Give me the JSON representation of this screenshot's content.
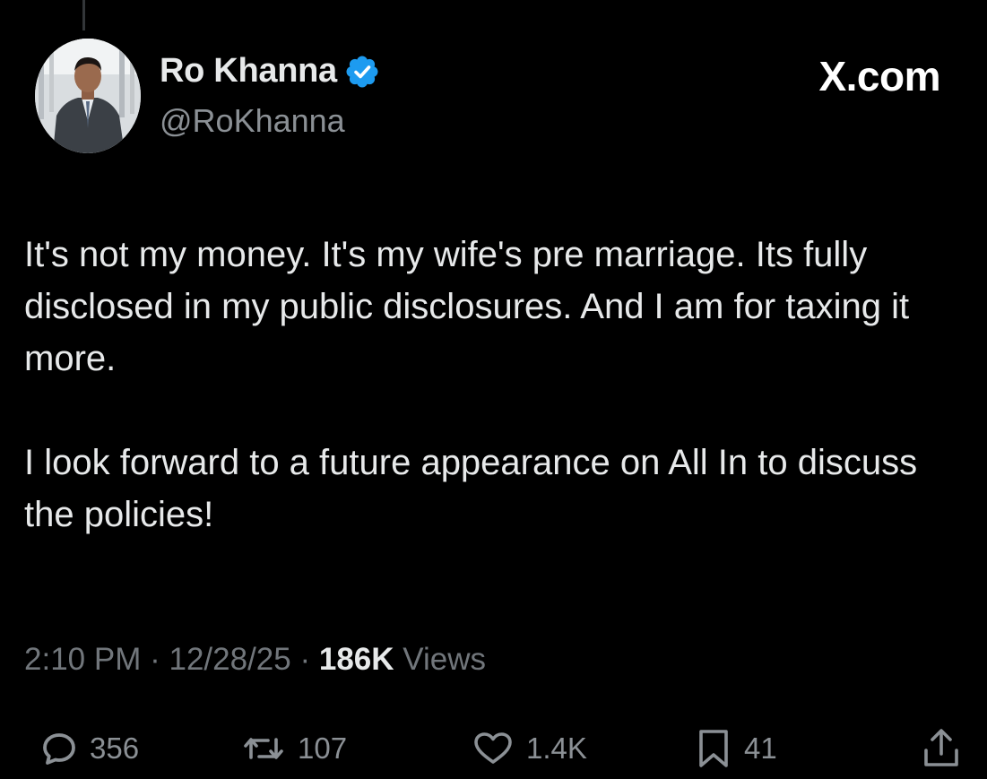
{
  "post": {
    "author": {
      "display_name": "Ro Khanna",
      "handle": "@RoKhanna",
      "verified": true,
      "verified_color": "#1d9bf0"
    },
    "brand": "X.com",
    "text_paragraphs": [
      "It's not my money. It's my wife's pre marriage. Its fully disclosed in my public disclosures. And I am for taxing it more.",
      "I look forward to a future appearance on All In to discuss the policies!"
    ],
    "meta": {
      "time": "2:10 PM",
      "separator": "·",
      "date": "12/28/25",
      "views_count": "186K",
      "views_label": "Views"
    },
    "actions": {
      "replies": "356",
      "reposts": "107",
      "likes": "1.4K",
      "bookmarks": "41"
    }
  },
  "icons": {
    "reply": "speech-bubble-icon",
    "repost": "repost-arrows-icon",
    "like": "heart-icon",
    "bookmark": "bookmark-icon",
    "share": "share-upload-icon",
    "verified": "verified-badge-icon"
  },
  "colors": {
    "background": "#000000",
    "text": "#e7e9ea",
    "secondary_text": "#71767b",
    "action_icons": "#8b9095"
  }
}
